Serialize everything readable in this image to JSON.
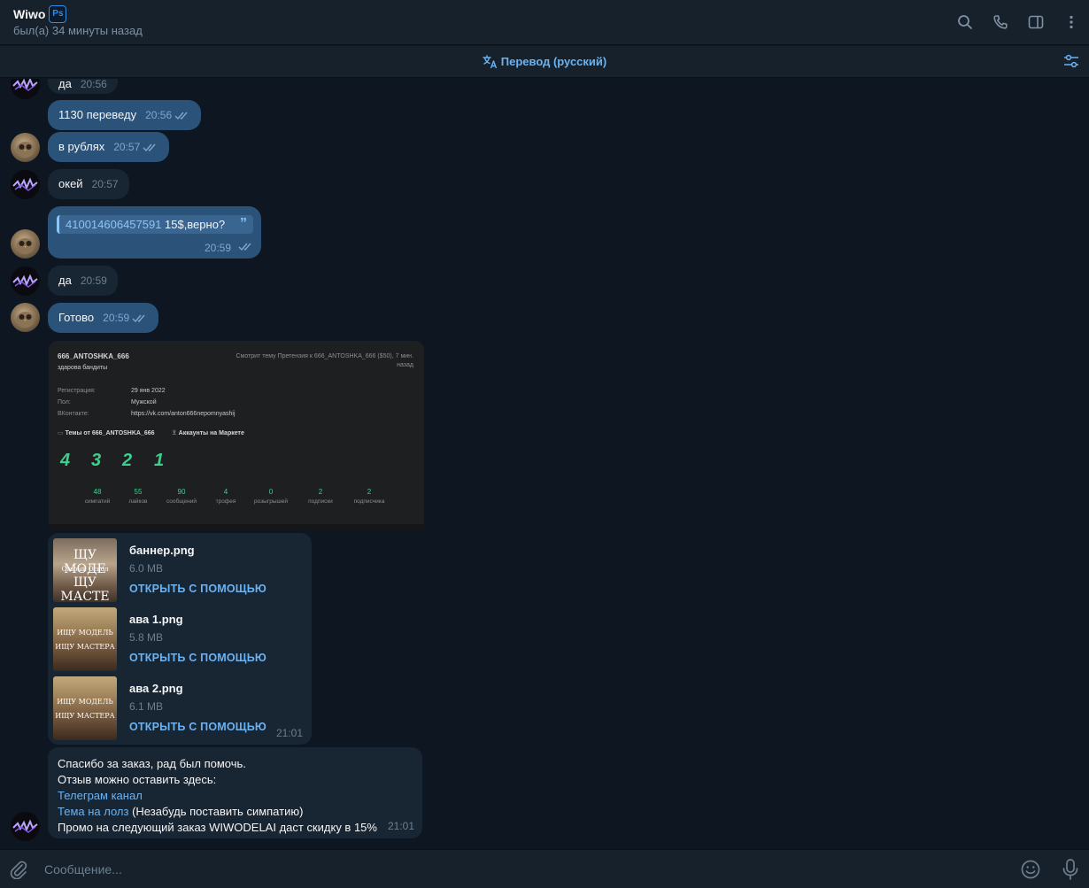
{
  "header": {
    "title": "Wiwo",
    "badge": "Ps",
    "status": "был(а) 34 минуты назад"
  },
  "translation_bar": {
    "label": "Перевод (русский)"
  },
  "messages": [
    {
      "text": "да",
      "time": "20:56"
    },
    {
      "text": "1130 переведу",
      "time": "20:56"
    },
    {
      "text": "в рублях",
      "time": "20:57"
    },
    {
      "text": "окей",
      "time": "20:57"
    },
    {
      "quote": "410014606457591",
      "text": "15$,верно?",
      "time": "20:59"
    },
    {
      "text": "да",
      "time": "20:59"
    },
    {
      "text": "Готово",
      "time": "20:59"
    }
  ],
  "screenshot": {
    "name": "666_ANTOSHKA_666",
    "bio": "здарова бандиты",
    "watching": "Смотрит тему Претензия к 666_ANTOSHKA_666 ($50), 7 мин. назад",
    "fields": [
      {
        "label": "Регистрация:",
        "value": "29 янв 2022"
      },
      {
        "label": "Пол:",
        "value": "Мужской"
      },
      {
        "label": "ВКонтакте:",
        "value": "https://vk.com/anton666nepomnyashij"
      }
    ],
    "tab1": "Темы от 666_ANTOSHKA_666",
    "tab2": "Аккаунты на Маркете",
    "badges": [
      "4",
      "3",
      "2",
      "1"
    ],
    "stats": [
      {
        "n": "48",
        "c": "симпатий"
      },
      {
        "n": "55",
        "c": "лайков"
      },
      {
        "n": "90",
        "c": "сообщений"
      },
      {
        "n": "4",
        "c": "трофея"
      },
      {
        "n": "0",
        "c": "розыгрышей"
      },
      {
        "n": "2",
        "c": "подписки"
      },
      {
        "n": "2",
        "c": "подписчика"
      }
    ]
  },
  "files": {
    "items": [
      {
        "name": "баннер.png",
        "size": "6.0 MB",
        "action": "ОТКРЫТЬ С ПОМОЩЬЮ"
      },
      {
        "name": "ава 1.png",
        "size": "5.8 MB",
        "action": "ОТКРЫТЬ С ПОМОЩЬЮ"
      },
      {
        "name": "ава 2.png",
        "size": "6.1 MB",
        "action": "ОТКРЫТЬ С ПОМОЩЬЮ"
      }
    ],
    "thumb1": {
      "line1": "ЩУ МОДЕ",
      "line2": "Старый Оскол",
      "line3": "ЩУ МАСТЕ"
    },
    "thumb2": {
      "line1": "ИЩУ МОДЕЛЬ",
      "line2": "ИЩУ МАСТЕРА"
    },
    "thumb3": {
      "line1": "ИЩУ МОДЕЛЬ",
      "line2": "ИЩУ МАСТЕРА"
    },
    "time": "21:01"
  },
  "final_message": {
    "line1": "Спасибо за заказ, рад был помочь.",
    "line2": "Отзыв можно оставить здесь:",
    "link1": "Телеграм канал",
    "link2": "Тема на лолз",
    "link2_suffix": " (Незабудь поставить симпатию)",
    "line5": "Промо на следующий заказ WIWODELAI даст скидку в 15%",
    "time": "21:01"
  },
  "input": {
    "placeholder": "Сообщение..."
  },
  "colors": {
    "background": "#0e1621",
    "header": "#17212b",
    "incoming": "#182533",
    "outgoing": "#2b5278",
    "accent": "#6ab3f3"
  },
  "icons": [
    "search-icon",
    "phone-icon",
    "sidebar-icon",
    "more-icon",
    "translate-icon",
    "settings-icon",
    "attach-icon",
    "emoji-icon",
    "mic-icon"
  ]
}
